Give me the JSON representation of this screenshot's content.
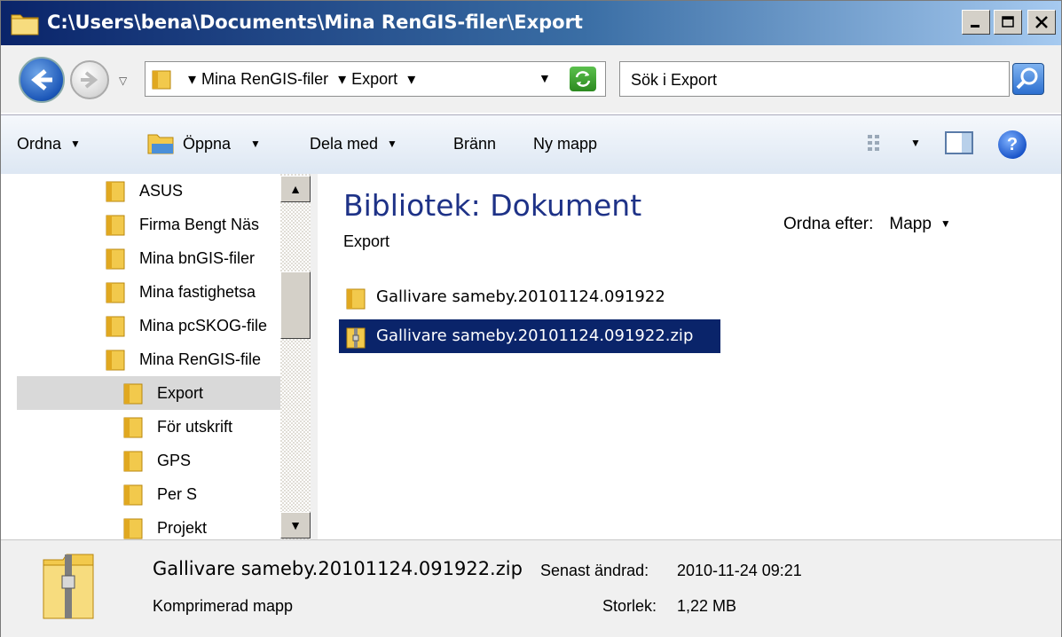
{
  "window": {
    "title": "C:\\Users\\bena\\Documents\\Mina RenGIS-filer\\Export",
    "buttons": [
      "minimize",
      "maximize",
      "close"
    ]
  },
  "address": {
    "breadcrumb": [
      "Mina RenGIS-filer",
      "Export"
    ],
    "search_placeholder": "Sök i Export"
  },
  "commandbar": {
    "organize": "Ordna",
    "open": "Öppna",
    "share": "Dela med",
    "burn": "Bränn",
    "new_folder": "Ny mapp"
  },
  "navtree": {
    "items": [
      {
        "label": "ASUS",
        "level": 0
      },
      {
        "label": "Firma Bengt Näs",
        "level": 0
      },
      {
        "label": "Mina bnGIS-filer",
        "level": 0
      },
      {
        "label": "Mina fastighetsa",
        "level": 0
      },
      {
        "label": "Mina pcSKOG-file",
        "level": 0
      },
      {
        "label": "Mina RenGIS-file",
        "level": 0
      },
      {
        "label": "Export",
        "level": 1,
        "selected": true
      },
      {
        "label": "För utskrift",
        "level": 1
      },
      {
        "label": "GPS",
        "level": 1
      },
      {
        "label": "Per S",
        "level": 1
      },
      {
        "label": "Projekt",
        "level": 1
      }
    ]
  },
  "content": {
    "library_title": "Bibliotek: Dokument",
    "library_subtitle": "Export",
    "sort_label": "Ordna efter:",
    "sort_value": "Mapp",
    "files": [
      {
        "name": "Gallivare sameby.20101124.091922",
        "icon": "folder-icon",
        "selected": false
      },
      {
        "name": "Gallivare sameby.20101124.091922.zip",
        "icon": "zip-folder-icon",
        "selected": true
      }
    ]
  },
  "details": {
    "name": "Gallivare sameby.20101124.091922.zip",
    "type": "Komprimerad mapp",
    "modified_label": "Senast ändrad:",
    "modified_value": "2010-11-24 09:21",
    "size_label": "Storlek:",
    "size_value": "1,22 MB"
  },
  "colors": {
    "selection": "#0a246a",
    "title_text": "#1e3287"
  }
}
